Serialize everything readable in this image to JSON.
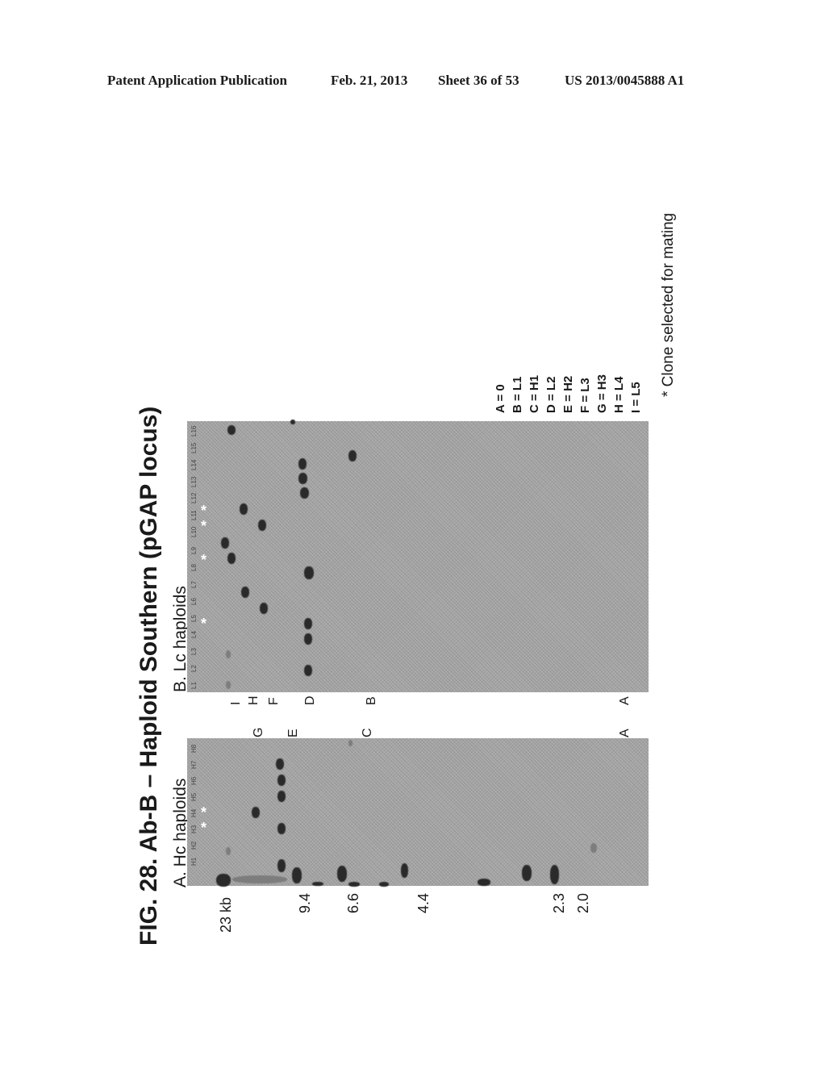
{
  "header": {
    "publication": "Patent Application Publication",
    "date": "Feb. 21, 2013",
    "sheet": "Sheet 36 of 53",
    "number": "US 2013/0045888 A1"
  },
  "figure": {
    "title": "FIG. 28. Ab-B – Haploid Southern (pGAP locus)",
    "panel_a": {
      "label": "A. Hc haploids",
      "lanes": [
        "H1",
        "H2",
        "H3",
        "H4",
        "H5",
        "H6",
        "H7",
        "H8"
      ],
      "selected_lanes": [
        "H3",
        "H4"
      ]
    },
    "panel_b": {
      "label": "B. Lc haploids",
      "lanes": [
        "L1",
        "L2",
        "L3",
        "L4",
        "L5",
        "L6",
        "L7",
        "L8",
        "L9",
        "L10",
        "L11",
        "L12",
        "L13",
        "L14",
        "L15",
        "L16"
      ],
      "selected_lanes": [
        "L5",
        "L9",
        "L11",
        "L12"
      ]
    },
    "band_letters_b": [
      "I",
      "H",
      "F",
      "D",
      "B",
      "A"
    ],
    "band_letters_a": [
      "G",
      "E",
      "C",
      "A"
    ],
    "size_markers": [
      "23 kb",
      "9.4",
      "6.6",
      "4.4",
      "2.3",
      "2.0"
    ],
    "legend": [
      "A = 0",
      "B = L1",
      "C = H1",
      "D = L2",
      "E = H2",
      "F = L3",
      "G = H3",
      "H = L4",
      "I = L5"
    ],
    "star_symbol": "*",
    "note": "* Clone selected for mating"
  }
}
